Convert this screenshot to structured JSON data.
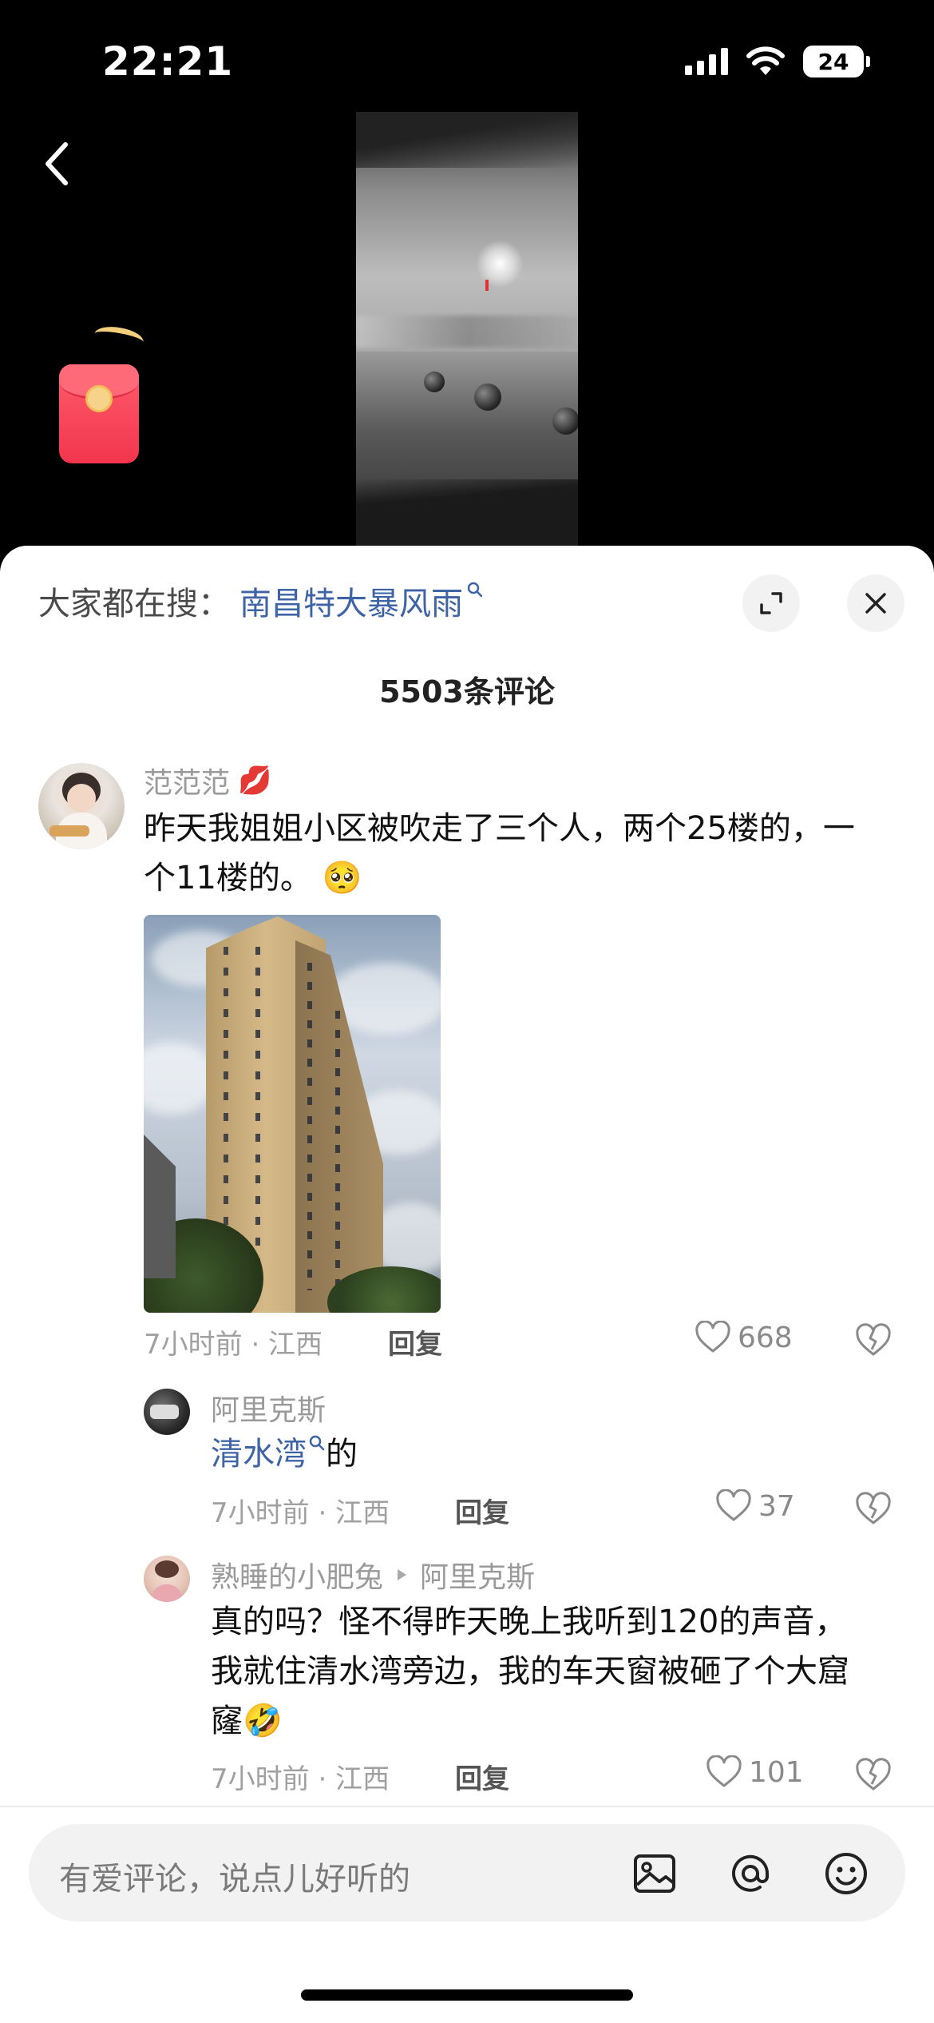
{
  "status_bar": {
    "time": "22:21",
    "battery": "24"
  },
  "search_hint": {
    "prefix": "大家都在搜：",
    "term": "南昌特大暴风雨"
  },
  "comments_header": {
    "count_label": "5503条评论"
  },
  "comments": [
    {
      "author": "范范范",
      "text": "昨天我姐姐小区被吹走了三个人，两个25楼的，一个11楼的。",
      "emoji": "🥺",
      "meta": "7小时前 · 江西",
      "reply_label": "回复",
      "likes": "668"
    }
  ],
  "replies": [
    {
      "author": "阿里克斯",
      "link_text": "清水湾",
      "text_suffix": "的",
      "meta": "7小时前 · 江西",
      "reply_label": "回复",
      "likes": "37"
    },
    {
      "author": "熟睡的小肥兔",
      "reply_to": "阿里克斯",
      "text": "真的吗？怪不得昨天晚上我听到120的声音，我就住清水湾旁边，我的车天窗被砸了个大窟窿",
      "emoji": "🤣",
      "meta": "7小时前 · 江西",
      "reply_label": "回复",
      "likes": "101"
    }
  ],
  "input": {
    "placeholder": "有爱评论，说点儿好听的"
  },
  "icons": {
    "back": "chevron-left-icon",
    "red_packet": "red-packet-icon",
    "expand": "expand-icon",
    "close": "close-icon",
    "like": "heart-icon",
    "dislike": "broken-heart-icon",
    "image": "image-icon",
    "mention": "at-icon",
    "emoji": "smiley-icon"
  },
  "colors": {
    "link": "#3e64a5",
    "sheet_bg": "#ffffff",
    "top_bg": "#000000",
    "red_packet": "#f2354d"
  }
}
